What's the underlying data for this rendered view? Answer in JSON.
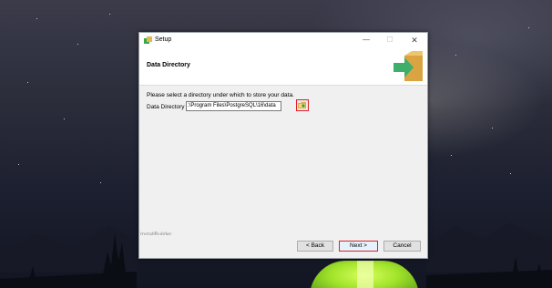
{
  "window": {
    "title": "Setup",
    "controls": {
      "minimize": "—",
      "maximize": "☐",
      "close": "✕"
    }
  },
  "header": {
    "title": "Data Directory",
    "graphic_icon": "box-arrow-icon"
  },
  "content": {
    "prompt": "Please select a directory under which to store your data.",
    "field_label": "Data Directory",
    "field_value": ":\\Program Files\\PostgreSQL\\16\\data",
    "browse_icon": "folder-browse-icon"
  },
  "branding": "InstallBuilder",
  "buttons": {
    "back": "< Back",
    "next": "Next >",
    "cancel": "Cancel"
  },
  "colors": {
    "highlight": "#e0202a",
    "dialog_bg": "#f0f0f0",
    "desktop_bg": "#1d2030"
  }
}
